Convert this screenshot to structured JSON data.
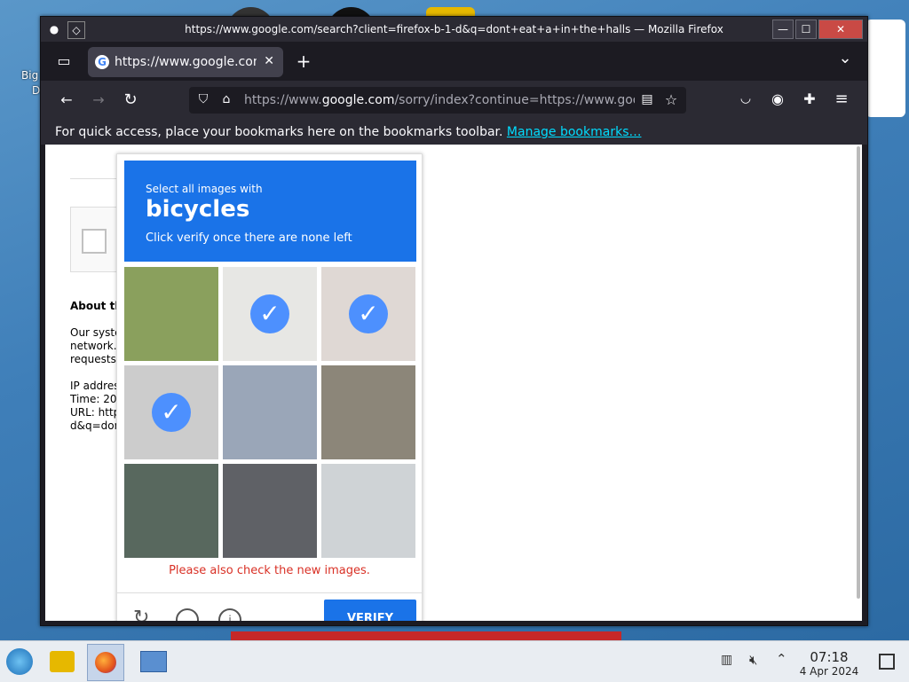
{
  "desktop": {
    "icon_label_1": "Big",
    "icon_label_2": "De"
  },
  "window": {
    "title": "https://www.google.com/search?client=firefox-b-1-d&q=dont+eat+a+in+the+halls — Mozilla Firefox",
    "controls": {
      "minimize": "—",
      "maximize": "☐",
      "close": "✕"
    }
  },
  "tabs": [
    {
      "favicon": "G",
      "title": "https://www.google.com/sorry/index",
      "close": "✕"
    }
  ],
  "new_tab": "+",
  "tab_list": "⌄",
  "nav": {
    "back": "←",
    "forward": "→",
    "reload": "↻"
  },
  "url": {
    "scheme": "https://www.",
    "host": "google.com",
    "rest": "/sorry/index?continue=https://www.google.com/search"
  },
  "bookmarks_bar": {
    "message": "For quick access, place your bookmarks here on the bookmarks toolbar. ",
    "link": "Manage bookmarks…"
  },
  "page": {
    "about": "About th",
    "para": [
      "Our syste",
      "network.",
      "requests"
    ],
    "ip": "IP addres",
    "time": "Time: 20",
    "url_line": "URL: http",
    "q_line": "d&q=don"
  },
  "captcha": {
    "line1": "Select all images with",
    "target": "bicycles",
    "line3": "Click verify once there are none left",
    "tiles": [
      {
        "name": "bridge",
        "selected": false,
        "color": "#8aa05d"
      },
      {
        "name": "bicycle-faded",
        "selected": true,
        "color": "#c9c9c4"
      },
      {
        "name": "cyclist-faded",
        "selected": true,
        "color": "#b8a8a0"
      },
      {
        "name": "cyclist-street",
        "selected": true,
        "color": "#8d8d8d"
      },
      {
        "name": "storefront",
        "selected": false,
        "color": "#9aa6b8"
      },
      {
        "name": "building",
        "selected": false,
        "color": "#8c8679"
      },
      {
        "name": "stairs",
        "selected": false,
        "color": "#58685e"
      },
      {
        "name": "car",
        "selected": false,
        "color": "#5f6166"
      },
      {
        "name": "parking-lot",
        "selected": false,
        "color": "#cfd3d6"
      }
    ],
    "check_glyph": "✓",
    "error": "Please also check the new images.",
    "verify": "VERIFY"
  },
  "taskbar": {
    "time": "07:18",
    "date": "4 Apr 2024"
  }
}
